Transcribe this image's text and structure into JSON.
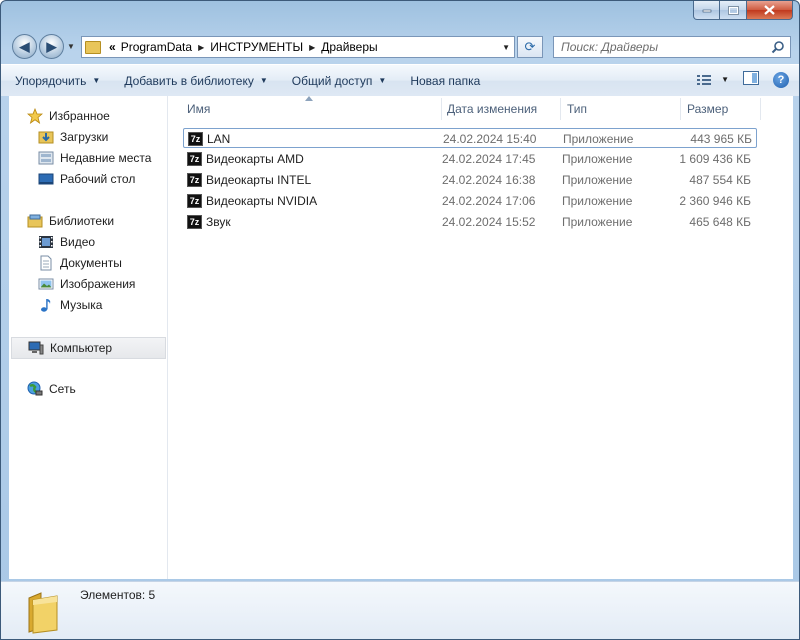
{
  "address": {
    "overflow": "«",
    "crumbs": [
      "ProgramData",
      "ИНСТРУМЕНТЫ",
      "Драйверы"
    ]
  },
  "search": {
    "placeholder": "Поиск: Драйверы"
  },
  "toolbar": {
    "organize": "Упорядочить",
    "add_library": "Добавить в библиотеку",
    "share": "Общий доступ",
    "new_folder": "Новая папка"
  },
  "sidebar": {
    "favorites": {
      "label": "Избранное",
      "items": [
        "Загрузки",
        "Недавние места",
        "Рабочий стол"
      ]
    },
    "libraries": {
      "label": "Библиотеки",
      "items": [
        "Видео",
        "Документы",
        "Изображения",
        "Музыка"
      ]
    },
    "computer": "Компьютер",
    "network": "Сеть"
  },
  "columns": {
    "name": "Имя",
    "date": "Дата изменения",
    "type": "Тип",
    "size": "Размер"
  },
  "files": [
    {
      "name": "LAN",
      "date": "24.02.2024 15:40",
      "type": "Приложение",
      "size": "443 965 КБ"
    },
    {
      "name": "Видеокарты AMD",
      "date": "24.02.2024 17:45",
      "type": "Приложение",
      "size": "1 609 436 КБ"
    },
    {
      "name": "Видеокарты INTEL",
      "date": "24.02.2024 16:38",
      "type": "Приложение",
      "size": "487 554 КБ"
    },
    {
      "name": "Видеокарты NVIDIA",
      "date": "24.02.2024 17:06",
      "type": "Приложение",
      "size": "2 360 946 КБ"
    },
    {
      "name": "Звук",
      "date": "24.02.2024 15:52",
      "type": "Приложение",
      "size": "465 648 КБ"
    }
  ],
  "file_icon_text": "7z",
  "status": {
    "items_count": "Элементов: 5"
  }
}
